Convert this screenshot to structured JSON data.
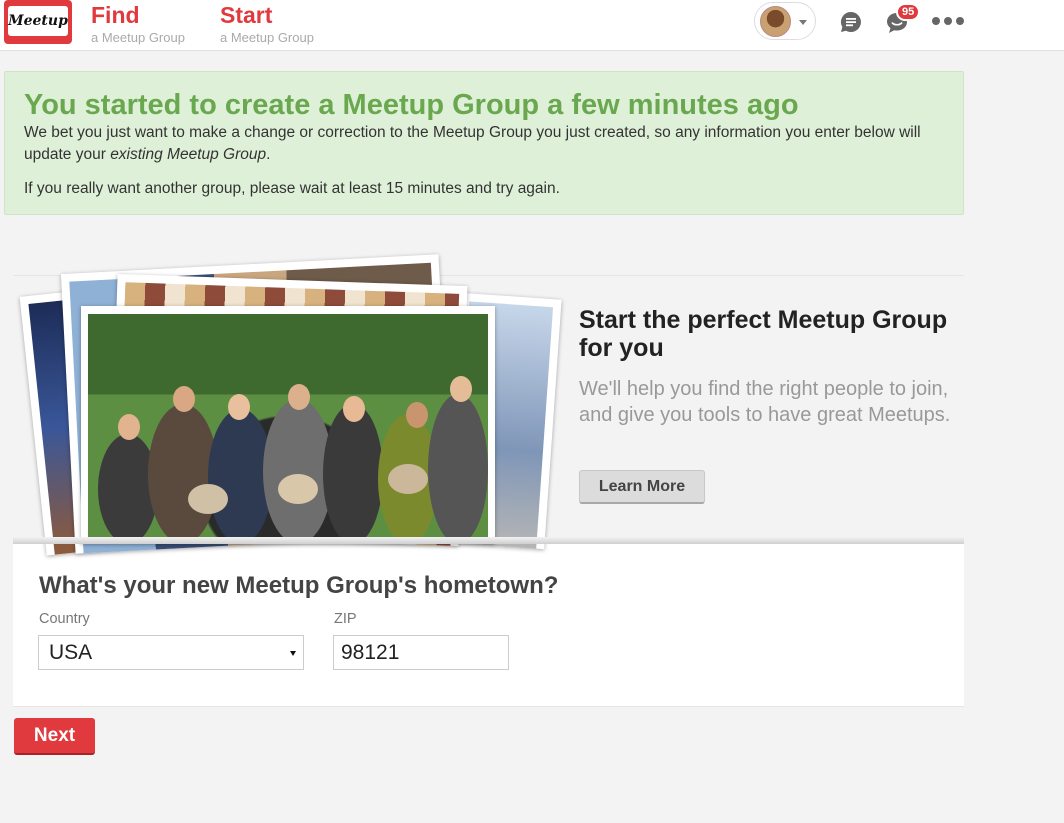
{
  "header": {
    "logo_text": "Meetup",
    "nav": [
      {
        "title": "Find",
        "subtitle": "a Meetup Group"
      },
      {
        "title": "Start",
        "subtitle": "a Meetup Group"
      }
    ],
    "notification_count": "95",
    "icons": [
      "chat-icon",
      "notification-icon",
      "more-icon",
      "avatar"
    ]
  },
  "notice": {
    "title": "You started to create a Meetup Group a few minutes ago",
    "line1_prefix": "We bet you just want to make a change or correction to the Meetup Group you just created, so any information you enter below will update your ",
    "line1_emphasis": "existing Meetup Group",
    "line1_suffix": ".",
    "line2": "If you really want another group, please wait at least 15 minutes and try again."
  },
  "hero": {
    "heading": "Start the perfect Meetup Group for you",
    "body": "We'll help you find the right people to join, and give you tools to have great Meetups.",
    "learn_more": "Learn More"
  },
  "form": {
    "title": "What's your new Meetup Group's hometown?",
    "country_label": "Country",
    "country_value": "USA",
    "zip_label": "ZIP",
    "zip_value": "98121"
  },
  "next_label": "Next",
  "colors": {
    "brand_red": "#e0393e",
    "notice_bg": "#dff0d8",
    "notice_title": "#6aa84f"
  }
}
